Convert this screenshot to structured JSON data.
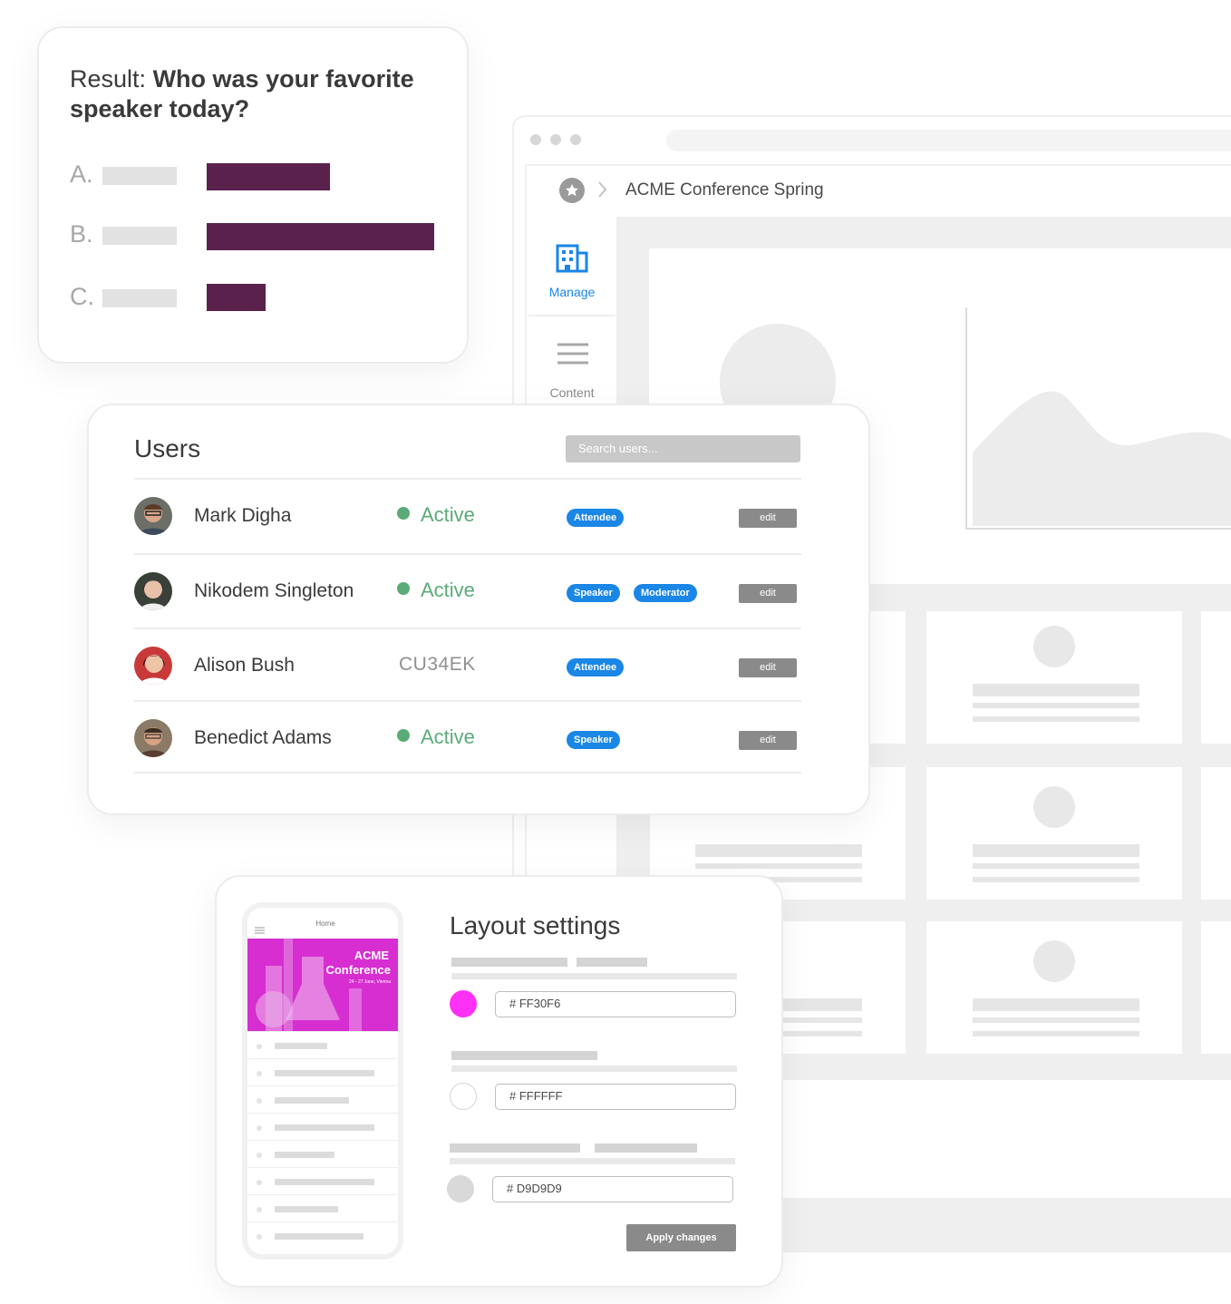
{
  "poll": {
    "prefix": "Result:",
    "question": "Who was your favorite speaker today?",
    "options": [
      {
        "letter": "A.",
        "value": 0.54
      },
      {
        "letter": "B.",
        "value": 1.0
      },
      {
        "letter": "C.",
        "value": 0.26
      }
    ],
    "bar_color": "#5a214d"
  },
  "app": {
    "breadcrumb_title": "ACME Conference Spring",
    "nav": [
      {
        "label": "Manage",
        "icon": "building-icon",
        "active": true
      },
      {
        "label": "Content",
        "icon": "menu-icon",
        "active": false
      }
    ],
    "accent": "#1a86e6"
  },
  "users": {
    "title": "Users",
    "search_placeholder": "Search users...",
    "rows": [
      {
        "name": "Mark Digha",
        "status": "Active",
        "badges": [
          "Attendee"
        ],
        "edit": "edit"
      },
      {
        "name": "Nikodem Singleton",
        "status": "Active",
        "badges": [
          "Speaker",
          "Moderator"
        ],
        "edit": "edit"
      },
      {
        "name": "Alison Bush",
        "code": "CU34EK",
        "badges": [
          "Attendee"
        ],
        "edit": "edit"
      },
      {
        "name": "Benedict Adams",
        "status": "Active",
        "badges": [
          "Speaker"
        ],
        "edit": "edit"
      }
    ],
    "status_color": "#5aab78"
  },
  "layout_settings": {
    "title": "Layout settings",
    "colors": [
      {
        "hex": "# FF30F6",
        "swatch": "#ff30f6"
      },
      {
        "hex": "# FFFFFF",
        "swatch": "#ffffff"
      },
      {
        "hex": "# D9D9D9",
        "swatch": "#d9d9d9"
      }
    ],
    "apply_label": "Apply changes",
    "phone": {
      "header": "Home",
      "banner_line1": "ACME",
      "banner_line2": "Conference",
      "banner_date": "24 - 27 June, Vienna",
      "banner_color": "#d62ed0"
    }
  }
}
